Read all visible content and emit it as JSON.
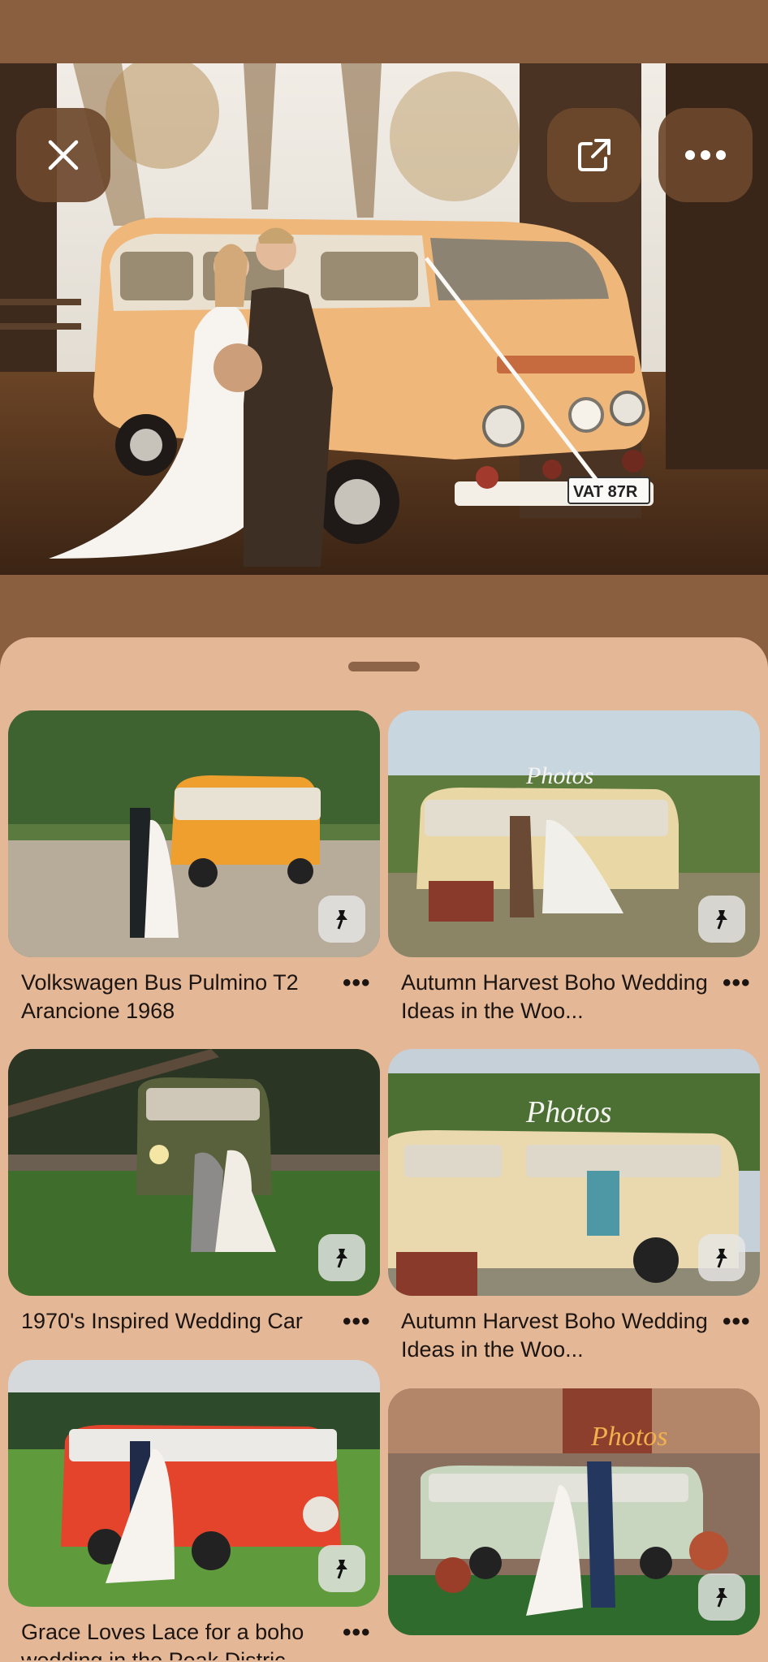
{
  "hero": {
    "alt_plate": "VAT 87R"
  },
  "top_buttons": {
    "close_icon": "close-icon",
    "share_icon": "external-link-icon",
    "more_icon": "more-horizontal-icon"
  },
  "pins": [
    {
      "title": "Volkswagen Bus Pulmino T2 Arancione 1968",
      "more": "•••",
      "icon": "pin-icon"
    },
    {
      "title": "Autumn Harvest Boho Wedding Ideas in the Woo...",
      "more": "•••",
      "icon": "pin-icon"
    },
    {
      "title": "1970's Inspired Wedding Car",
      "more": "•••",
      "icon": "pin-icon"
    },
    {
      "title": "Autumn Harvest Boho Wedding Ideas in the Woo...",
      "more": "•••",
      "icon": "pin-icon"
    },
    {
      "title": "Grace Loves Lace for a boho wedding in the Peak Distric...",
      "more": "•••",
      "icon": "pin-icon"
    },
    {
      "title": "",
      "more": "",
      "icon": "pin-icon"
    }
  ],
  "colors": {
    "background": "#8a5f3f",
    "sheet": "#e4b797",
    "button": "#6c482c"
  }
}
